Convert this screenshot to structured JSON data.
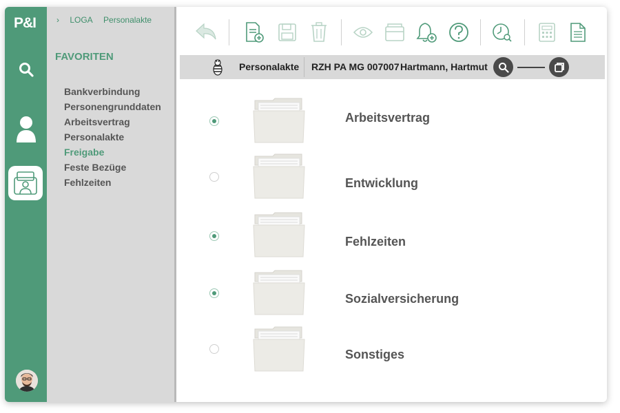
{
  "app": {
    "logo": "P&I"
  },
  "rail": {
    "items": [
      {
        "name": "search",
        "icon": "search-icon"
      },
      {
        "name": "person",
        "icon": "person-icon"
      },
      {
        "name": "personnel-file",
        "icon": "personnel-file-icon",
        "active": true
      }
    ]
  },
  "breadcrumb": {
    "items": [
      "LOGA",
      "Personalakte"
    ]
  },
  "favorites": {
    "title": "FAVORITEN",
    "items": [
      "Bankverbindung",
      "Personengrunddaten",
      "Arbeitsvertrag",
      "Personalakte",
      "Freigabe",
      "Feste Bezüge",
      "Fehlzeiten"
    ],
    "active": "Freigabe"
  },
  "toolbar": {
    "icons": [
      "undo-icon",
      "new-document-icon",
      "save-icon",
      "delete-icon",
      "view-icon",
      "archive-icon",
      "notification-add-icon",
      "help-icon",
      "time-search-icon",
      "calculator-icon",
      "document-icon"
    ]
  },
  "header": {
    "title": "Personalakte",
    "record": "RZH PA MG 007007",
    "person": "Hartmann, Hartmut"
  },
  "documents": [
    {
      "label": "Arbeitsvertrag",
      "checked": true
    },
    {
      "label": "Entwicklung",
      "checked": false
    },
    {
      "label": "Fehlzeiten",
      "checked": true
    },
    {
      "label": "Sozialversicherung",
      "checked": true
    },
    {
      "label": "Sonstiges",
      "checked": false
    }
  ],
  "colors": {
    "accent": "#4f9a79",
    "sidebar": "#d9d9d9",
    "header": "#d9d9d9"
  }
}
